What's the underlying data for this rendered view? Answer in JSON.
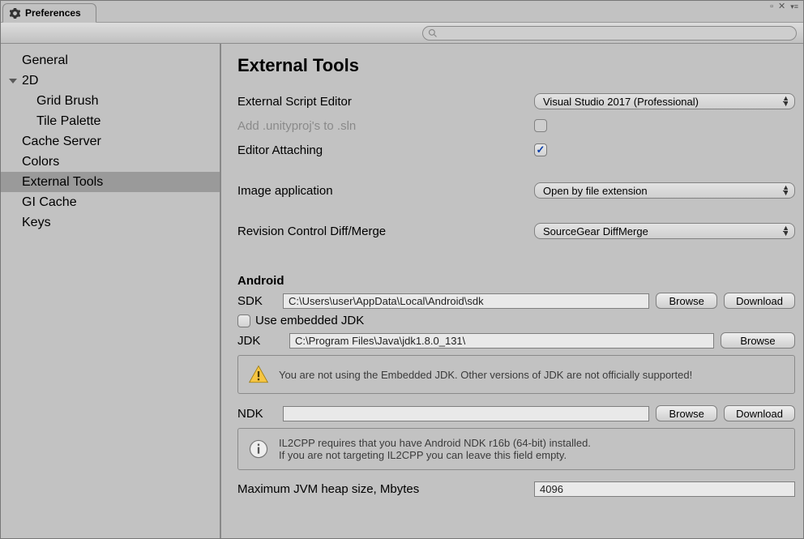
{
  "window": {
    "tab_title": "Preferences"
  },
  "search": {
    "placeholder": ""
  },
  "sidebar": {
    "items": [
      {
        "label": "General"
      },
      {
        "label": "2D",
        "expanded": true
      },
      {
        "label": "Grid Brush",
        "child": true
      },
      {
        "label": "Tile Palette",
        "child": true
      },
      {
        "label": "Cache Server"
      },
      {
        "label": "Colors"
      },
      {
        "label": "External Tools",
        "selected": true
      },
      {
        "label": "GI Cache"
      },
      {
        "label": "Keys"
      }
    ]
  },
  "page": {
    "title": "External Tools",
    "fields": {
      "external_script_editor": {
        "label": "External Script Editor",
        "value": "Visual Studio 2017 (Professional)"
      },
      "add_unityproj": {
        "label": "Add .unityproj's to .sln",
        "checked": false,
        "disabled": true
      },
      "editor_attaching": {
        "label": "Editor Attaching",
        "checked": true
      },
      "image_application": {
        "label": "Image application",
        "value": "Open by file extension"
      },
      "revision_control": {
        "label": "Revision Control Diff/Merge",
        "value": "SourceGear DiffMerge"
      }
    },
    "android": {
      "heading": "Android",
      "sdk": {
        "label": "SDK",
        "value": "C:\\Users\\user\\AppData\\Local\\Android\\sdk",
        "browse": "Browse",
        "download": "Download"
      },
      "use_embedded_jdk": {
        "label": "Use embedded JDK",
        "checked": false
      },
      "jdk": {
        "label": "JDK",
        "value": "C:\\Program Files\\Java\\jdk1.8.0_131\\",
        "browse": "Browse"
      },
      "jdk_warning": "You are not using the Embedded JDK. Other versions of JDK are not officially supported!",
      "ndk": {
        "label": "NDK",
        "value": "",
        "browse": "Browse",
        "download": "Download"
      },
      "ndk_info_line1": "IL2CPP requires that you have Android NDK r16b (64-bit) installed.",
      "ndk_info_line2": "If you are not targeting IL2CPP you can leave this field empty.",
      "heap": {
        "label": "Maximum JVM heap size, Mbytes",
        "value": "4096"
      }
    }
  }
}
